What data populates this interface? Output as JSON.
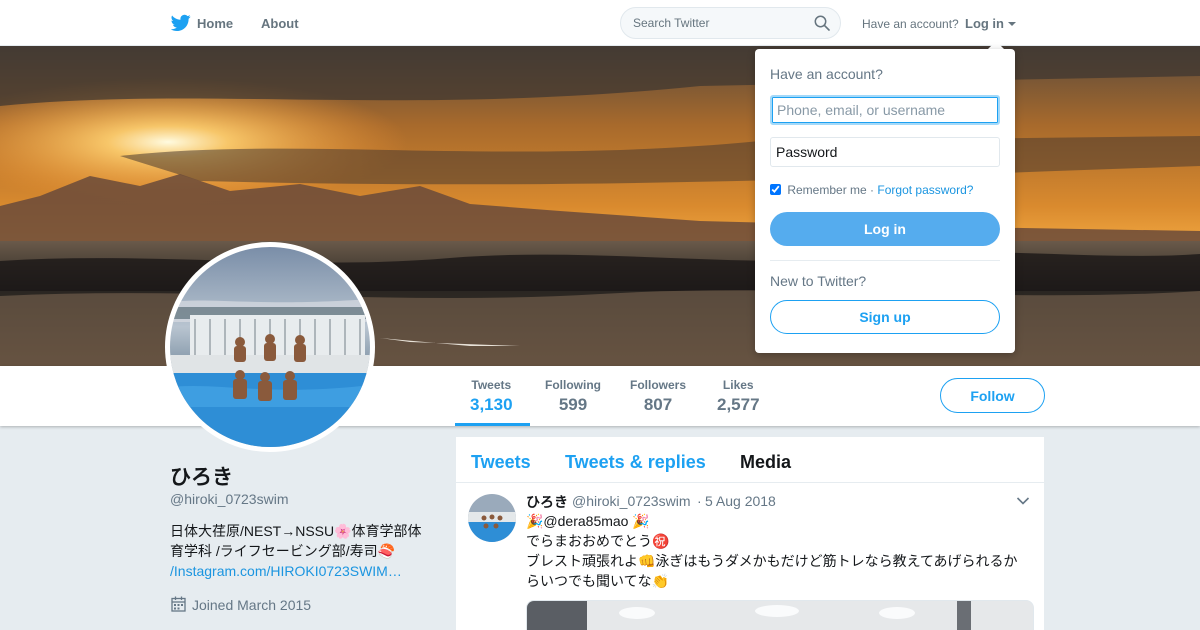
{
  "nav": {
    "logo_icon": "twitter-bird-icon",
    "home": "Home",
    "about": "About",
    "search_placeholder": "Search Twitter",
    "have_account": "Have an account?",
    "login": "Log in"
  },
  "profile": {
    "name": "ひろき",
    "handle": "@hiroki_0723swim",
    "bio_line1": "日体大荏原/NEST→NSSU🌸体育学部体育学科 /ライフセービング部/寿司🍣",
    "bio_link": "/Instagram.com/HIROKI0723SWIM…",
    "joined": "Joined March 2015",
    "follow": "Follow"
  },
  "stats": [
    {
      "label": "Tweets",
      "value": "3,130",
      "active": true
    },
    {
      "label": "Following",
      "value": "599",
      "active": false
    },
    {
      "label": "Followers",
      "value": "807",
      "active": false
    },
    {
      "label": "Likes",
      "value": "2,577",
      "active": false
    }
  ],
  "tabs": [
    "Tweets",
    "Tweets & replies",
    "Media"
  ],
  "tweet": {
    "name": "ひろき",
    "handle": "@hiroki_0723swim",
    "dot": "·",
    "date": "5 Aug 2018",
    "line1": "🎉@dera85mao 🎉",
    "line2": "でらまおおめでとう㊗️",
    "line3": "ブレスト頑張れよ👊泳ぎはもうダメかもだけど筋トレなら教えてあげられるからいつでも聞いてな👏"
  },
  "login_dropdown": {
    "title": "Have an account?",
    "username_placeholder": "Phone, email, or username",
    "password_placeholder": "Password",
    "remember": "Remember me",
    "sep": "·",
    "forgot": "Forgot password?",
    "login_button": "Log in",
    "new_to": "New to Twitter?",
    "signup_button": "Sign up"
  },
  "colors": {
    "accent": "#1da1f2",
    "login_button": "#55acee",
    "background": "#e6ecf0"
  }
}
